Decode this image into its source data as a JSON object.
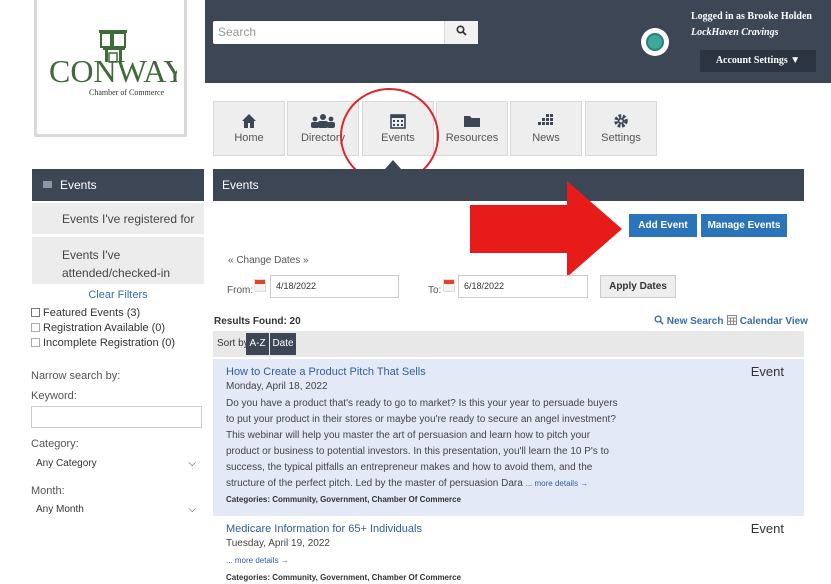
{
  "header": {
    "search_placeholder": "Search",
    "user_line1": "Logged in as Brooke Holden",
    "user_line2": "LockHaven Cravings",
    "account_settings": "Account Settings ▼"
  },
  "logo": {
    "name": "CONWAY",
    "subtitle": "Chamber of Commerce"
  },
  "nav": {
    "tiles": [
      {
        "label": "Home"
      },
      {
        "label": "Directory"
      },
      {
        "label": "Events"
      },
      {
        "label": "Resources"
      },
      {
        "label": "News"
      },
      {
        "label": "Settings"
      }
    ]
  },
  "sidebar": {
    "heading": "Events",
    "items": [
      {
        "label": "Events I've registered for"
      },
      {
        "label_line1": "Events I've",
        "label_line2": "attended/checked-in"
      }
    ],
    "clear_filters": "Clear Filters",
    "filters": [
      {
        "label": "Featured Events (3)",
        "checked": false
      },
      {
        "label": "Registration Available (0)",
        "checked": false
      },
      {
        "label": "Incomplete Registration (0)",
        "checked": false
      }
    ],
    "narrow_label": "Narrow search by:",
    "keyword_label": "Keyword:",
    "category_label": "Category:",
    "category_value": "Any Category",
    "month_label": "Month:",
    "month_value": "Any Month"
  },
  "main": {
    "title": "Events",
    "add_event": "Add Event",
    "manage_events": "Manage Events",
    "change_dates": "« Change Dates »",
    "from_label": "From:",
    "from_value": "4/18/2022",
    "to_label": "To:",
    "to_value": "6/18/2022",
    "apply_dates": "Apply Dates",
    "results_found": "Results Found: 20",
    "new_search": "New Search",
    "calendar_view": "Calendar View",
    "sort_label": "Sort by:",
    "sort_az": "A-Z",
    "sort_date": "Date",
    "events": [
      {
        "title": "How to Create a Product Pitch That Sells",
        "type": "Event",
        "date": "Monday, April 18, 2022",
        "desc_lines": [
          "Do you have a product that's ready to go to market? Is this your year to persuade buyers",
          "to put your product in their stores or maybe you're ready to secure an angel investment?",
          "This webinar will help you master the art of persuasion and learn how to pitch your",
          "product or business to potential investors. In this presentation, you'll learn the 10 P's to",
          "success, the typical pitfalls an entrepreneur makes and how to avoid them, and the",
          "structure of the perfect pitch.  Led by the master of persuasion Dara"
        ],
        "more": "... more details →",
        "categories": "Categories: Community, Government, Chamber Of Commerce"
      },
      {
        "title": "Medicare Information for 65+ Individuals",
        "type": "Event",
        "date": "Tuesday, April 19, 2022",
        "more": "... more details →",
        "categories": "Categories: Community, Government, Chamber Of Commerce"
      }
    ]
  },
  "colors": {
    "header_bg": "#3d4655",
    "accent_blue": "#2c74b9",
    "highlight_red": "#e0262a",
    "card_bg": "#e4e9f8"
  }
}
